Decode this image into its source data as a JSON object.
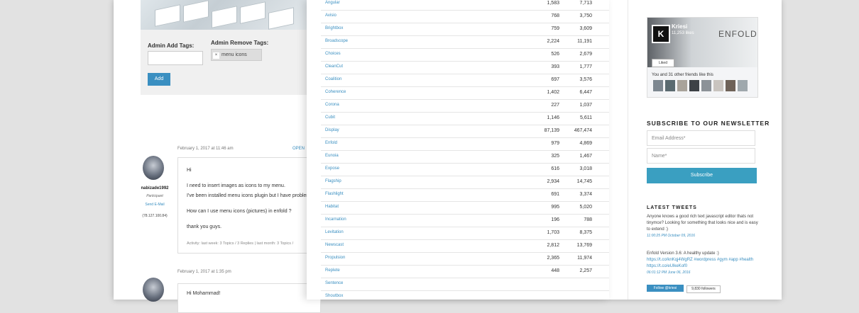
{
  "left": {
    "admin_add_tags_label": "Admin Add Tags:",
    "admin_remove_tags_label": "Admin Remove Tags:",
    "remove_tag_value": "menu icons",
    "add_button": "Add",
    "posts": [
      {
        "date": "February 1, 2017 at 11:46 am",
        "open_label": "OPEN",
        "username": "nabizade1992",
        "role": "Participant",
        "email_link": "Send E-Mail",
        "ip": "(78.127.100.84)",
        "lines": [
          "Hi",
          "I need to insert images as icons to my menu.",
          "I've been installed menu icons plugin but I have problem",
          "How can I use menu icons (pictures) in enfold ?",
          "thank you guys."
        ],
        "activity": "Activity: last week: 3 Topics / 3 Replies | last month: 3 Topics /"
      },
      {
        "date": "February 1, 2017 at 1:35 pm",
        "lines": [
          "Hi Mohammad!"
        ]
      }
    ]
  },
  "table": {
    "rows": [
      {
        "name": "Angular",
        "v1": "1,583",
        "v2": "7,713"
      },
      {
        "name": "Avisio",
        "v1": "768",
        "v2": "3,750"
      },
      {
        "name": "Brightbox",
        "v1": "759",
        "v2": "3,609"
      },
      {
        "name": "Broadscope",
        "v1": "2,224",
        "v2": "11,191"
      },
      {
        "name": "Choices",
        "v1": "526",
        "v2": "2,679"
      },
      {
        "name": "CleanCut",
        "v1": "393",
        "v2": "1,777"
      },
      {
        "name": "Coalition",
        "v1": "697",
        "v2": "3,576"
      },
      {
        "name": "Coherence",
        "v1": "1,402",
        "v2": "6,447"
      },
      {
        "name": "Corona",
        "v1": "227",
        "v2": "1,037"
      },
      {
        "name": "Cubit",
        "v1": "1,146",
        "v2": "5,611"
      },
      {
        "name": "Display",
        "v1": "87,139",
        "v2": "467,474"
      },
      {
        "name": "Enfold",
        "v1": "979",
        "v2": "4,869"
      },
      {
        "name": "Eunoia",
        "v1": "325",
        "v2": "1,467"
      },
      {
        "name": "Expose",
        "v1": "616",
        "v2": "3,018"
      },
      {
        "name": "Flagship",
        "v1": "2,934",
        "v2": "14,745"
      },
      {
        "name": "Flashlight",
        "v1": "691",
        "v2": "3,374"
      },
      {
        "name": "Habitat",
        "v1": "995",
        "v2": "5,020"
      },
      {
        "name": "Incarnation",
        "v1": "196",
        "v2": "788"
      },
      {
        "name": "Levitation",
        "v1": "1,703",
        "v2": "8,375"
      },
      {
        "name": "Newscast",
        "v1": "2,812",
        "v2": "13,769"
      },
      {
        "name": "Propulsion",
        "v1": "2,365",
        "v2": "11,974"
      },
      {
        "name": "Replete",
        "v1": "448",
        "v2": "2,257"
      },
      {
        "name": "Sentence",
        "v1": "",
        "v2": ""
      },
      {
        "name": "Shoutbox",
        "v1": "",
        "v2": ""
      }
    ]
  },
  "sidebar": {
    "fb": {
      "logo": "K",
      "name": "Kriesi",
      "likes": "11,253 likes",
      "brand": "ENFOLD",
      "liked": "Liked",
      "friends": "You and 31 other friends like this"
    },
    "newsletter_heading": "SUBSCRIBE TO OUR NEWSLETTER",
    "email_placeholder": "Email Address*",
    "name_placeholder": "Name*",
    "subscribe": "Subscribe",
    "tweets_heading": "LATEST TWEETS",
    "tweets": [
      {
        "text": "Anyone knows a good rich text javascript editor thats not tinymce? Looking for something that looks nice and is easy to extend :)",
        "date": "11:00:25 PM October 09, 2016"
      },
      {
        "text": "Enfold Version 3.6: A healthy update :)",
        "link": "https://t.co/knKqj4WgRZ #wordpress #gym #app #health https://t.co/eUlkeKof0",
        "date": "06:01:12 PM June 06, 2016"
      }
    ],
    "follow": "Follow @kriesi",
    "followers": "9,830 followers"
  }
}
